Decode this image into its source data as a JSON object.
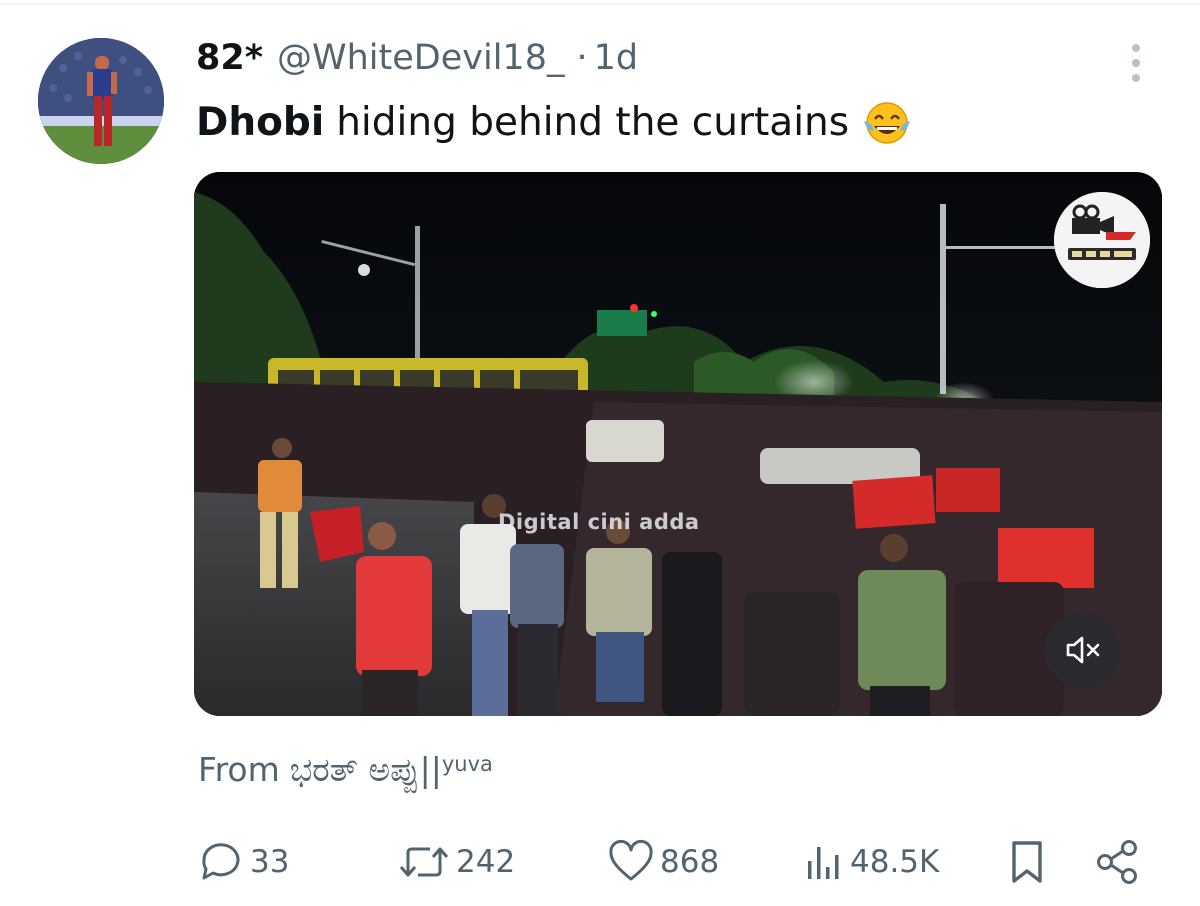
{
  "post": {
    "display_name": "82*",
    "handle": "@WhiteDevil18_",
    "separator": "·",
    "age": "1d",
    "text_bold": "Dhobi",
    "text_rest": "hiding behind the curtains",
    "emoji": "face-with-tears-of-joy",
    "source_prefix": "From",
    "source_name": "ಭರತ್ ಅಪ್ಪು||",
    "source_sup": "yuva"
  },
  "media": {
    "watermark": "Digital cini adda",
    "logo": "digital-cini-adda-logo",
    "mute_icon": "volume-muted-icon"
  },
  "actions": {
    "replies": "33",
    "reposts": "242",
    "likes": "868",
    "views": "48.5K"
  },
  "colors": {
    "text": "#0f1419",
    "muted": "#536471",
    "divider": "#eff3f4",
    "rcb_red": "#d42a2a"
  }
}
